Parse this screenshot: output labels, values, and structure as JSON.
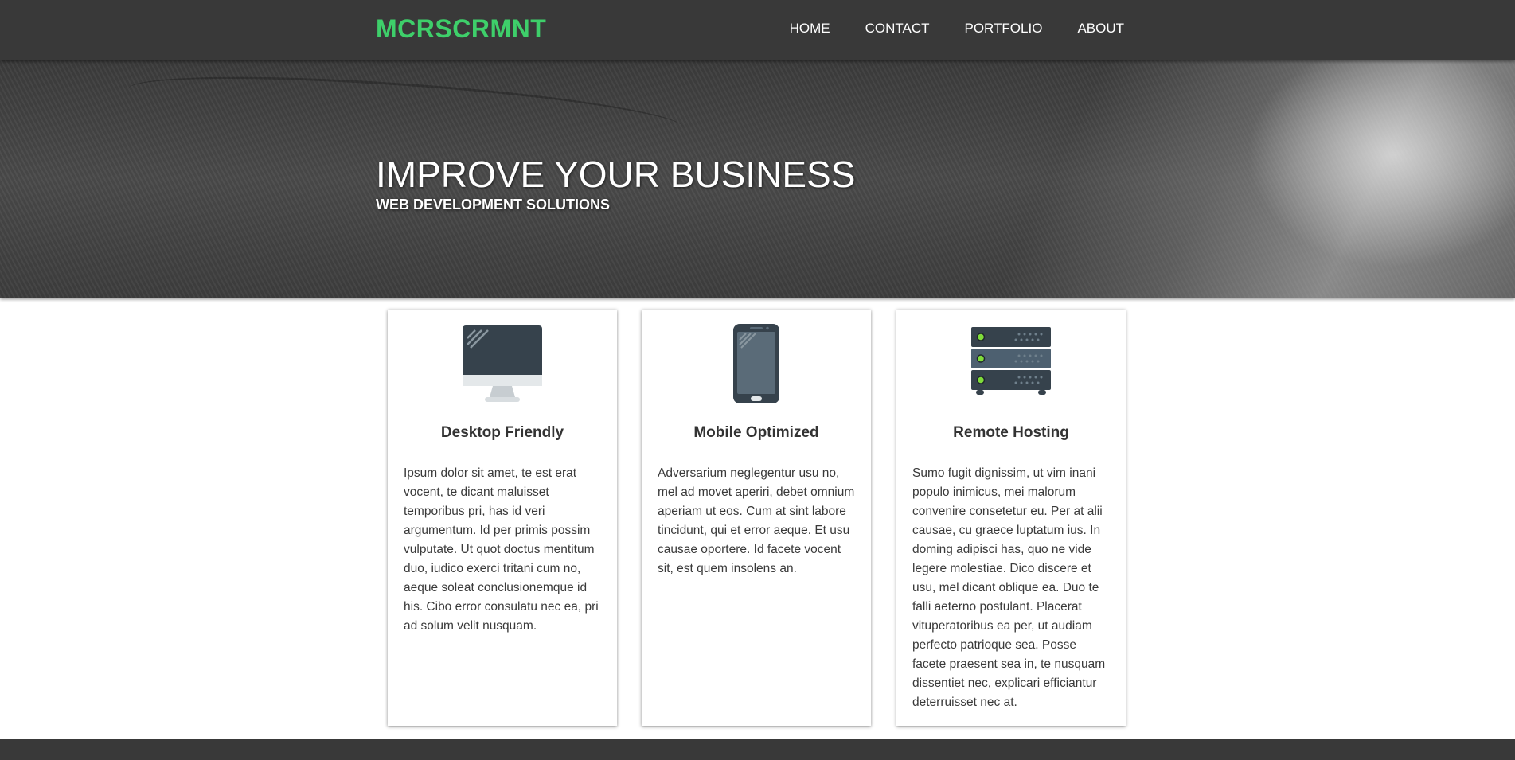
{
  "brand": "MCRSCRMNT",
  "nav": {
    "home": "HOME",
    "contact": "CONTACT",
    "portfolio": "PORTFOLIO",
    "about": "ABOUT"
  },
  "hero": {
    "title": "IMPROVE YOUR BUSINESS",
    "subtitle": "WEB DEVELOPMENT SOLUTIONS"
  },
  "cards": [
    {
      "icon": "desktop-monitor-icon",
      "title": "Desktop Friendly",
      "text": "Ipsum dolor sit amet, te est erat vocent, te dicant maluisset temporibus pri, has id veri argumentum. Id per primis possim vulputate. Ut quot doctus mentitum duo, iudico exerci tritani cum no, aeque soleat conclusionemque id his. Cibo error consulatu nec ea, pri ad solum velit nusquam."
    },
    {
      "icon": "smartphone-icon",
      "title": "Mobile Optimized",
      "text": "Adversarium neglegentur usu no, mel ad movet aperiri, debet omnium aperiam ut eos. Cum at sint labore tincidunt, qui et error aeque. Et usu causae oportere. Id facete vocent sit, est quem insolens an."
    },
    {
      "icon": "server-rack-icon",
      "title": "Remote Hosting",
      "text": "Sumo fugit dignissim, ut vim inani populo inimicus, mei malorum convenire consetetur eu. Per at alii causae, cu graece luptatum ius. In doming adipisci has, quo ne vide legere molestiae. Dico discere et usu, mel dicant oblique ea. Duo te falli aeterno postulant. Placerat vituperatoribus ea per, ut audiam perfecto patrioque sea. Posse facete praesent sea in, te nusquam dissentiet nec, explicari efficiantur deterruisset nec at."
    }
  ],
  "colors": {
    "navbar": "#393939",
    "brand": "#3ecf6a",
    "footer": "#393939",
    "icon_dark": "#36424c",
    "icon_led": "#7fdc3a"
  }
}
